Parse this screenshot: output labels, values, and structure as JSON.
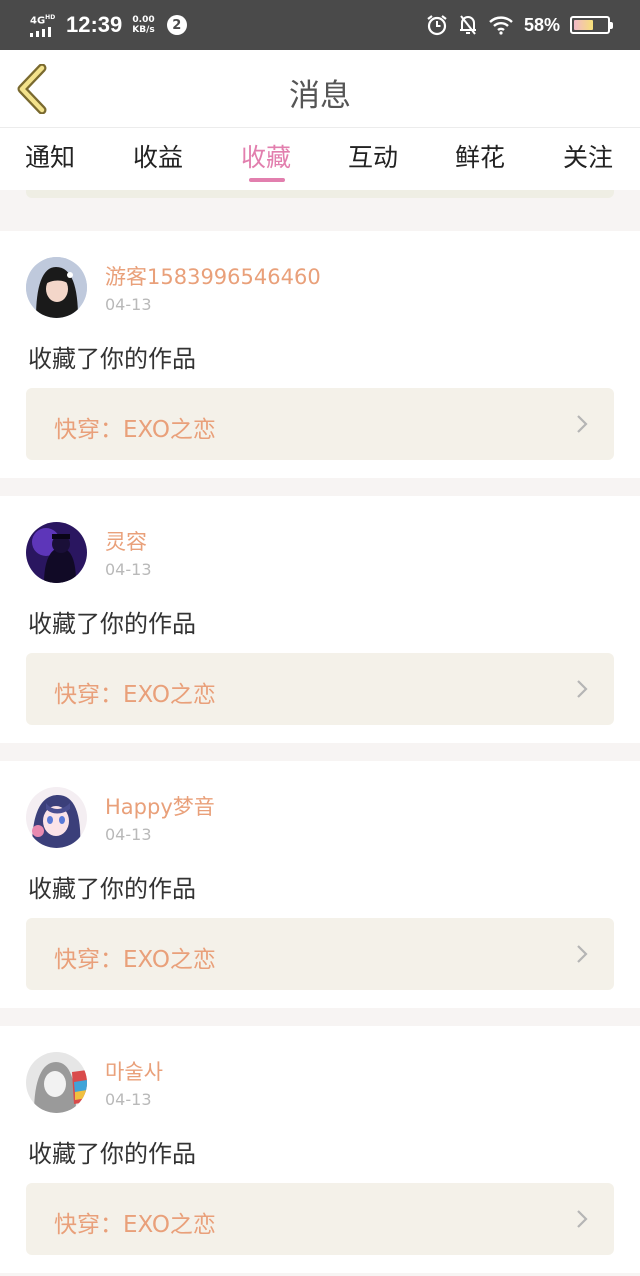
{
  "status_bar": {
    "network": "4G",
    "network_sup": "HD",
    "time": "12:39",
    "speed_value": "0.00",
    "speed_unit": "KB/s",
    "notification_count": "2",
    "battery_percent": "58%",
    "battery_level": 0.58
  },
  "header": {
    "title": "消息"
  },
  "tabs": [
    {
      "label": "通知"
    },
    {
      "label": "收益"
    },
    {
      "label": "收藏",
      "active": true
    },
    {
      "label": "互动"
    },
    {
      "label": "鲜花"
    },
    {
      "label": "关注"
    }
  ],
  "messages": [
    {
      "user": "游客1583996546460",
      "date": "04-13",
      "action": "收藏了你的作品",
      "work": "快穿：EXO之恋"
    },
    {
      "user": "灵容",
      "date": "04-13",
      "action": "收藏了你的作品",
      "work": "快穿：EXO之恋"
    },
    {
      "user": "Happy梦音",
      "date": "04-13",
      "action": "收藏了你的作品",
      "work": "快穿：EXO之恋"
    },
    {
      "user": "마술사",
      "date": "04-13",
      "action": "收藏了你的作品",
      "work": "快穿：EXO之恋"
    }
  ],
  "colors": {
    "accent": "#e27fae",
    "username": "#e9a07a",
    "status_bar": "#4a4a4a"
  }
}
